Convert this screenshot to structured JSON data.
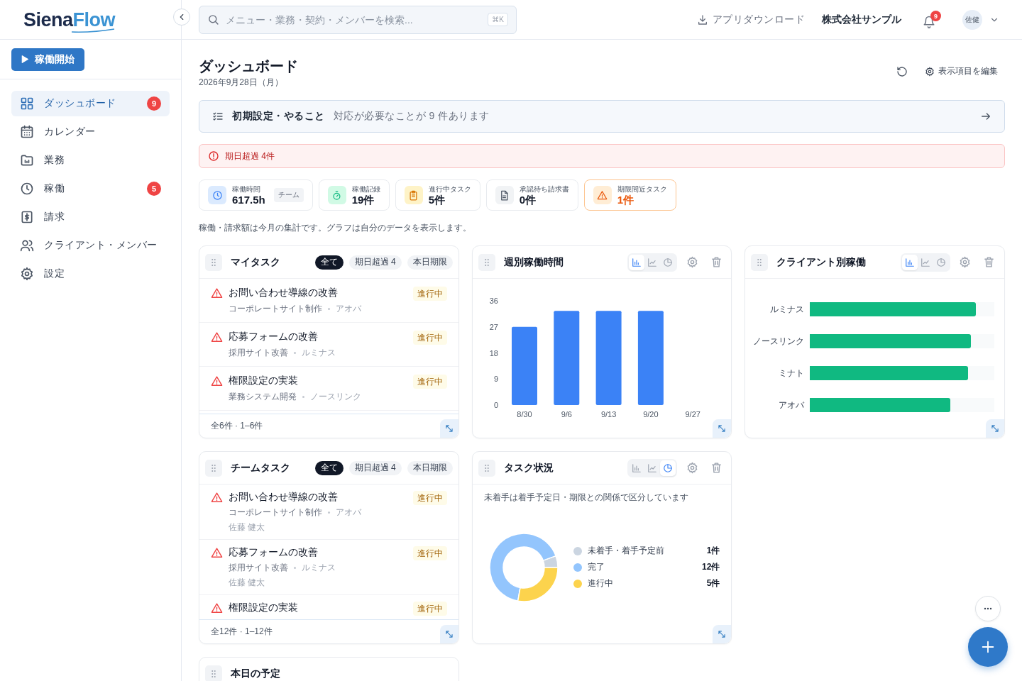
{
  "sidebar": {
    "logo": {
      "first": "Siena",
      "second": "Flow"
    },
    "start_button": "稼働開始",
    "items": [
      {
        "kind": "dashboard",
        "label": "ダッシュボード",
        "badge": "9",
        "selected": true
      },
      {
        "kind": "calendar",
        "label": "カレンダー",
        "selected": false
      },
      {
        "kind": "work",
        "label": "業務",
        "selected": false
      },
      {
        "kind": "time",
        "label": "稼働",
        "badge": "5",
        "selected": false
      },
      {
        "kind": "billing",
        "label": "請求",
        "selected": false
      },
      {
        "kind": "members",
        "label": "クライアント・メンバー",
        "selected": false
      },
      {
        "kind": "settings",
        "label": "設定",
        "selected": false
      }
    ]
  },
  "header": {
    "search": {
      "placeholder": "メニュー・業務・契約・メンバーを検索..."
    },
    "shortcut": "⌘K",
    "download": "アプリダウンロード",
    "company": "株式会社サンプル",
    "notification_count": "9",
    "avatar": "佐健"
  },
  "page": {
    "title": "ダッシュボード",
    "date": "2026年9月28日（月）",
    "edit_button": "表示項目を編集"
  },
  "setup_banner": {
    "title": "初期設定・やること",
    "message": "対応が必要なことが 9 件あります"
  },
  "alert": {
    "text": "期日超過 4件"
  },
  "kpis": [
    {
      "kind": "time",
      "label": "稼働時間",
      "value": "617.5h",
      "tag": "チーム"
    },
    {
      "kind": "records",
      "label": "稼働記録",
      "value": "19件"
    },
    {
      "kind": "tasks",
      "label": "進行中タスク",
      "value": "5件"
    },
    {
      "kind": "invoices",
      "label": "承認待ち請求書",
      "value": "0件"
    },
    {
      "kind": "deadline",
      "label": "期限間近タスク",
      "value": "1件"
    }
  ],
  "note": "稼働・請求額は今月の集計です。グラフは自分のデータを表示します。",
  "my_tasks": {
    "title": "マイタスク",
    "filters": [
      {
        "label": "全て",
        "selected": true
      },
      {
        "label": "期日超過 4",
        "selected": false
      },
      {
        "label": "本日期限",
        "selected": false
      }
    ],
    "tasks": [
      {
        "title": "お問い合わせ導線の改善",
        "status": "進行中",
        "project": "コーポレートサイト制作",
        "client": "アオバ",
        "overdue": true
      },
      {
        "title": "応募フォームの改善",
        "status": "進行中",
        "project": "採用サイト改善",
        "client": "ルミナス",
        "overdue": true
      },
      {
        "title": "権限設定の実装",
        "status": "進行中",
        "project": "業務システム開発",
        "client": "ノースリンク",
        "overdue": true
      }
    ],
    "footer": "全6件 · 1–6件"
  },
  "weekly_hours": {
    "title": "週別稼働時間",
    "chart_types": [
      {
        "kind": "bar",
        "selected": true
      },
      {
        "kind": "line",
        "selected": false
      },
      {
        "kind": "pie",
        "selected": false
      }
    ],
    "chart_data": {
      "type": "bar",
      "categories": [
        "8/30",
        "9/6",
        "9/13",
        "9/20",
        "9/27"
      ],
      "values": [
        27,
        32.5,
        32.5,
        32.5,
        null
      ],
      "ylim": [
        0,
        36
      ],
      "yticks": [
        0,
        9,
        18,
        27,
        36
      ]
    }
  },
  "client_hours": {
    "title": "クライアント別稼働",
    "chart_types": [
      {
        "kind": "bar",
        "selected": true
      },
      {
        "kind": "line",
        "selected": false
      },
      {
        "kind": "pie",
        "selected": false
      }
    ],
    "bars": [
      {
        "label": "ルミナス",
        "level": 0.9
      },
      {
        "label": "ノースリンク",
        "level": 0.87
      },
      {
        "label": "ミナト",
        "level": 0.855
      },
      {
        "label": "アオバ",
        "level": 0.76
      }
    ]
  },
  "team_tasks": {
    "title": "チームタスク",
    "filters": [
      {
        "label": "全て",
        "selected": true
      },
      {
        "label": "期日超過 4",
        "selected": false
      },
      {
        "label": "本日期限",
        "selected": false
      }
    ],
    "tasks": [
      {
        "title": "お問い合わせ導線の改善",
        "status": "進行中",
        "project": "コーポレートサイト制作",
        "client": "アオバ",
        "assignee": "佐藤 健太",
        "overdue": true
      },
      {
        "title": "応募フォームの改善",
        "status": "進行中",
        "project": "採用サイト改善",
        "client": "ルミナス",
        "assignee": "佐藤 健太",
        "overdue": true
      },
      {
        "title": "権限設定の実装",
        "status": "進行中",
        "overdue": true
      }
    ],
    "footer": "全12件 · 1–12件"
  },
  "task_status": {
    "title": "タスク状況",
    "chart_types": [
      {
        "kind": "bar",
        "selected": false
      },
      {
        "kind": "line",
        "selected": false
      },
      {
        "kind": "pie",
        "selected": true
      }
    ],
    "note": "未着手は着手予定日・期限との関係で区分しています",
    "legend": [
      {
        "label": "未着手・着手予定前",
        "count": "1件",
        "color": "#cbd5e1"
      },
      {
        "label": "完了",
        "count": "12件",
        "color": "#93c5fd"
      },
      {
        "label": "進行中",
        "count": "5件",
        "color": "#fcd34d"
      }
    ]
  },
  "today_schedule": {
    "title": "本日の予定"
  }
}
